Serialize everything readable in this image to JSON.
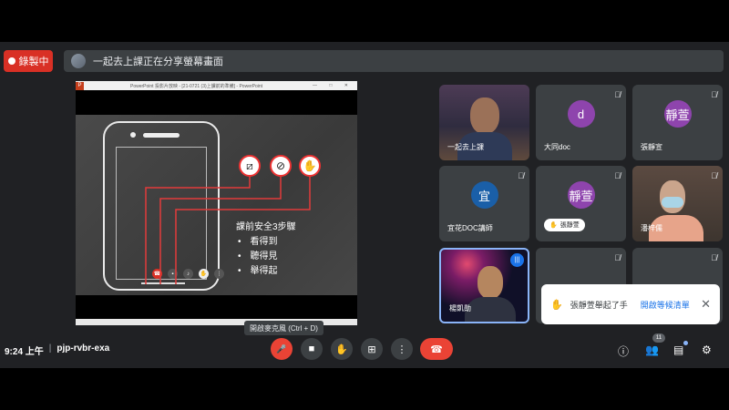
{
  "recording": {
    "label": "錄製中"
  },
  "banner": {
    "text": "一起去上課正在分享螢幕畫面"
  },
  "presentation": {
    "window_logo": "P",
    "window_title": "PowerPoint 投影片放映 - [21-0721 (3)上課前的準備] - PowerPoint",
    "window_controls": "—  □  ✕",
    "slide_title": "課前安全3步驟",
    "steps": [
      "看得到",
      "聽得見",
      "舉得起"
    ],
    "icons": {
      "camera_off": "camera-off-icon",
      "mic_off": "mic-off-icon",
      "raise_hand": "hand-icon"
    }
  },
  "tooltip": "開啟麥克風 (Ctrl + D)",
  "tiles": [
    {
      "name": "一起去上課",
      "initial": "",
      "color": "",
      "muted": false
    },
    {
      "name": "大同doc",
      "initial": "d",
      "color": "#8e44ad",
      "muted": true
    },
    {
      "name": "張靜宣",
      "initial": "靜萱",
      "color": "#8e44ad",
      "muted": true
    },
    {
      "name": "宜花DOC講師",
      "initial": "宜",
      "color": "#1a5fa8",
      "muted": true
    },
    {
      "name": "張靜萱",
      "initial": "靜萱",
      "color": "#8e44ad",
      "muted": true,
      "hand_raised": true
    },
    {
      "name": "潘梓儒",
      "initial": "",
      "color": "",
      "muted": true
    },
    {
      "name": "楊凱勛",
      "initial": "",
      "color": "",
      "muted": false,
      "speaking": true
    },
    {
      "name": "",
      "initial": "",
      "color": "",
      "muted": true
    },
    {
      "name": "",
      "initial": "",
      "color": "",
      "muted": true
    }
  ],
  "toast": {
    "text": "張靜萱舉起了手",
    "action": "開啟等候清單",
    "close": "✕"
  },
  "meta": {
    "time": "9:24 上午",
    "separator": "|",
    "code": "pjp-rvbr-exa"
  },
  "controls": {
    "mic": "🎤",
    "camera": "■",
    "hand": "✋",
    "present": "⊞",
    "more": "⋮",
    "end": "☎"
  },
  "right": {
    "info": "ⓘ",
    "people": "👥",
    "people_count": "11",
    "chat": "▤",
    "activities": "⚙"
  }
}
